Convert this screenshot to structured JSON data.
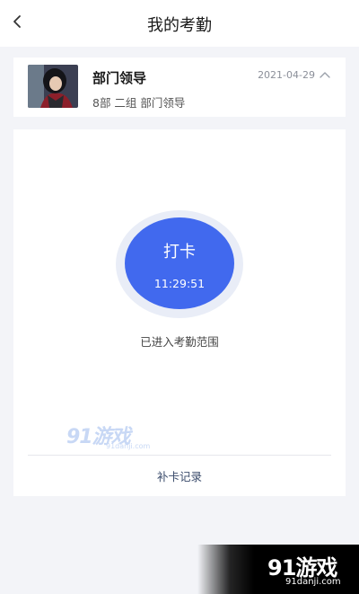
{
  "header": {
    "title": "我的考勤"
  },
  "user": {
    "name": "部门领导",
    "department": "8部 二组 部门领导",
    "date": "2021-04-29"
  },
  "punch": {
    "label": "打卡",
    "time": "11:29:51",
    "status": "已进入考勤范围"
  },
  "footer": {
    "supplement_link": "补卡记录"
  },
  "watermarks": {
    "mid_logo": "91游戏",
    "mid_url": "91danji.com",
    "corner_logo": "91游戏",
    "corner_url": "91danji.com"
  },
  "icons": {
    "back": "chevron-left-icon",
    "collapse": "chevron-up-icon"
  },
  "colors": {
    "accent": "#4169ee",
    "ring": "#e9edf7",
    "background": "#f3f4f8"
  }
}
